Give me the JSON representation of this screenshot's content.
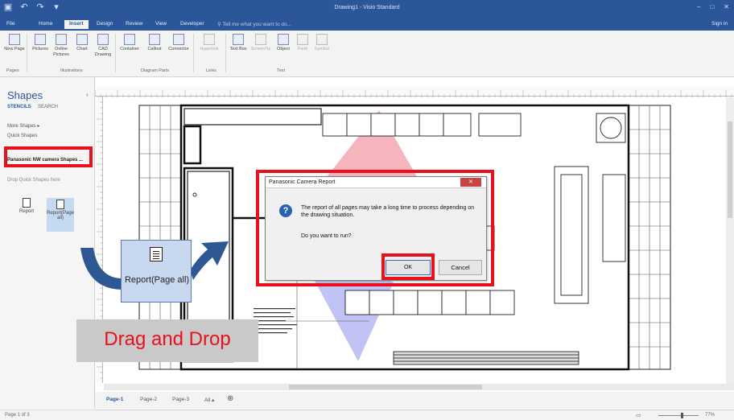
{
  "window": {
    "title": "Drawing1 - Visio Standard",
    "controls": [
      "–",
      "□",
      "✕"
    ]
  },
  "ribbon": {
    "tabs": [
      "File",
      "Home",
      "Insert",
      "Design",
      "Review",
      "View",
      "Developer"
    ],
    "active_tab": "Insert",
    "tell_me": "Tell me what you want to do...",
    "sign_in": "Sign in",
    "buttons": [
      {
        "label": "New Page",
        "icon": "new-page-icon"
      },
      {
        "label": "Pictures",
        "icon": "pictures-icon"
      },
      {
        "label": "Online Pictures",
        "icon": "online-pictures-icon"
      },
      {
        "label": "Chart",
        "icon": "chart-icon"
      },
      {
        "label": "CAD Drawing",
        "icon": "cad-drawing-icon"
      },
      {
        "label": "Container",
        "icon": "container-icon"
      },
      {
        "label": "Callout",
        "icon": "callout-icon"
      },
      {
        "label": "Connector",
        "icon": "connector-icon"
      },
      {
        "label": "Hyperlink",
        "icon": "hyperlink-icon"
      },
      {
        "label": "Text Box",
        "icon": "text-box-icon"
      },
      {
        "label": "ScreenTip",
        "icon": "screentip-icon"
      },
      {
        "label": "Object",
        "icon": "object-icon"
      },
      {
        "label": "Field",
        "icon": "field-icon"
      },
      {
        "label": "Symbol",
        "icon": "symbol-icon"
      }
    ],
    "groups": [
      "Pages",
      "Illustrations",
      "Diagram Parts",
      "Links",
      "Text"
    ]
  },
  "shapes_pane": {
    "title": "Shapes",
    "tabs": [
      "STENCILS",
      "SEARCH"
    ],
    "more_shapes": "More Shapes",
    "quick_shapes": "Quick Shapes",
    "stencil_faded": "Panasonic NW camera shapes",
    "stencil_selected": "Panasonic NW camera Shapes ...",
    "drop_hint": "Drop Quick Shapes here",
    "items": [
      {
        "label": "Report"
      },
      {
        "label": "Report(Page all)"
      }
    ]
  },
  "page_tabs": {
    "tabs": [
      "Page-1",
      "Page-2",
      "Page-3",
      "All"
    ],
    "active": "Page-1",
    "add_icon": "add-page-icon"
  },
  "status": {
    "page": "Page 1 of 3",
    "zoom": "77%"
  },
  "dialog": {
    "title": "Panasonic Camera Report",
    "message": "The report of all pages may take a long time to process depending on the drawing situation.",
    "question": "Do you want to run?",
    "ok": "OK",
    "cancel": "Cancel",
    "icon": "question-icon"
  },
  "overlay": {
    "drag_item_label": "Report(Page all)",
    "drag_text": "Drag and Drop"
  },
  "colors": {
    "title_bar": "#2b579a",
    "highlight": "#e8101a",
    "camera_view_red": "#f4a7b0",
    "camera_view_blue": "#b9bdf3"
  }
}
